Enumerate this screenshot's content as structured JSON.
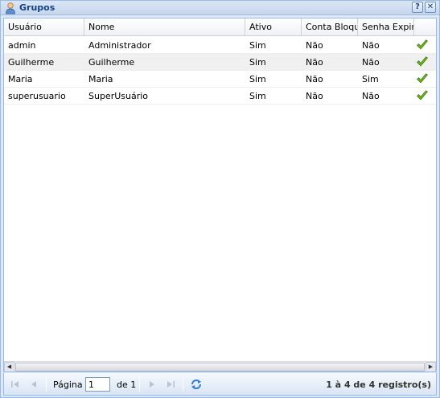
{
  "window": {
    "title": "Grupos",
    "help_label": "?",
    "close_label": "✕"
  },
  "grid": {
    "columns": [
      "Usuário",
      "Nome",
      "Ativo",
      "Conta Bloque",
      "Senha Expiro",
      ""
    ],
    "rows": [
      {
        "usuario": "admin",
        "nome": "Administrador",
        "ativo": "Sim",
        "conta_bloqueada": "Não",
        "senha_expirou": "Não",
        "status_icon": "check-icon"
      },
      {
        "usuario": "Guilherme",
        "nome": "Guilherme",
        "ativo": "Sim",
        "conta_bloqueada": "Não",
        "senha_expirou": "Não",
        "status_icon": "check-icon"
      },
      {
        "usuario": "Maria",
        "nome": "Maria",
        "ativo": "Sim",
        "conta_bloqueada": "Não",
        "senha_expirou": "Sim",
        "status_icon": "check-icon"
      },
      {
        "usuario": "superusuario",
        "nome": "SuperUsuário",
        "ativo": "Sim",
        "conta_bloqueada": "Não",
        "senha_expirou": "Não",
        "status_icon": "check-icon"
      }
    ]
  },
  "paging": {
    "page_label": "Página",
    "page_value": "1",
    "of_label": "de 1",
    "status": "1 à 4 de 4 registro(s)"
  },
  "colors": {
    "title": "#15428b",
    "border": "#99bbe8",
    "check": "#6cb01f"
  }
}
